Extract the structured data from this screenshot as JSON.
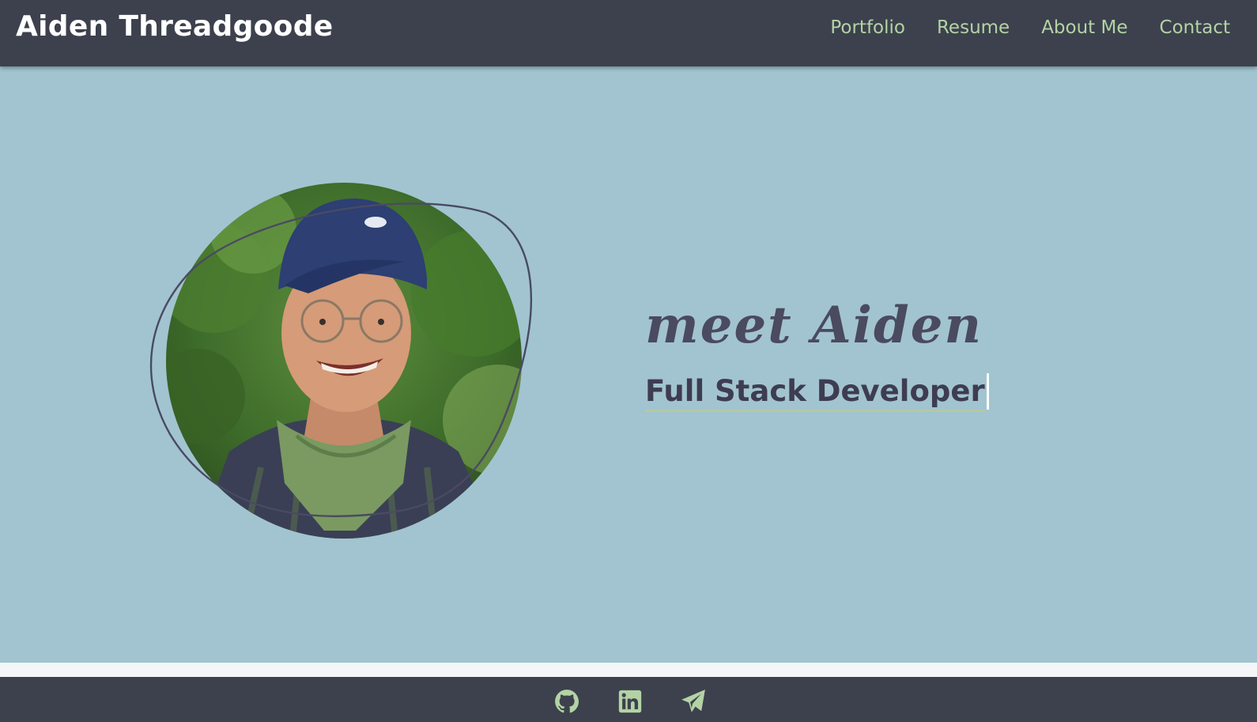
{
  "header": {
    "brand": "Aiden Threadgoode",
    "nav": [
      {
        "label": "Portfolio"
      },
      {
        "label": "Resume"
      },
      {
        "label": "About Me"
      },
      {
        "label": "Contact"
      }
    ]
  },
  "hero": {
    "greeting": "meet Aiden",
    "role": "Full Stack Developer",
    "portrait_icon": "profile-photo"
  },
  "footer": {
    "icons": [
      "github-icon",
      "linkedin-icon",
      "paper-plane-icon"
    ]
  },
  "colors": {
    "nav_bg": "#3d414d",
    "nav_link": "#b3d3a5",
    "hero_bg": "#a1c4d0",
    "heading_text": "#3e3c52",
    "underline": "#b3c9a2"
  }
}
